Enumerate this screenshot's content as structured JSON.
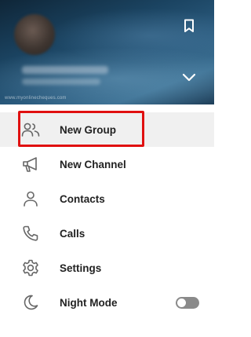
{
  "header": {
    "watermark": "www.myonlinecheques.com",
    "saved_icon": "bookmark-icon",
    "expand_icon": "chevron-down-icon"
  },
  "menu": {
    "items": [
      {
        "label": "New Group",
        "icon": "group-icon"
      },
      {
        "label": "New Channel",
        "icon": "megaphone-icon"
      },
      {
        "label": "Contacts",
        "icon": "person-icon"
      },
      {
        "label": "Calls",
        "icon": "phone-icon"
      },
      {
        "label": "Settings",
        "icon": "gear-icon"
      },
      {
        "label": "Night Mode",
        "icon": "moon-icon",
        "toggle": "off"
      }
    ],
    "highlight_color": "#e01010",
    "hover_bg": "#f0f0f0"
  }
}
